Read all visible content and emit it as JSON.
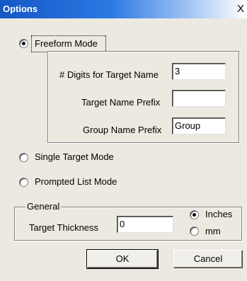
{
  "window": {
    "title": "Options",
    "close_glyph": "X"
  },
  "modes": {
    "freeform_label": "Freeform Mode",
    "single_label": "Single Target Mode",
    "prompted_label": "Prompted List Mode",
    "selected": "freeform"
  },
  "freeform": {
    "digits_label": "# Digits for Target Name",
    "digits_value": "3",
    "prefix_label": "Target Name Prefix",
    "prefix_value": "",
    "group_prefix_label": "Group Name Prefix",
    "group_prefix_value": "Group"
  },
  "general": {
    "legend": "General",
    "thickness_label": "Target Thickness",
    "thickness_value": "0",
    "units_inches": "Inches",
    "units_mm": "mm",
    "units_selected": "inches"
  },
  "buttons": {
    "ok": "OK",
    "cancel": "Cancel"
  }
}
